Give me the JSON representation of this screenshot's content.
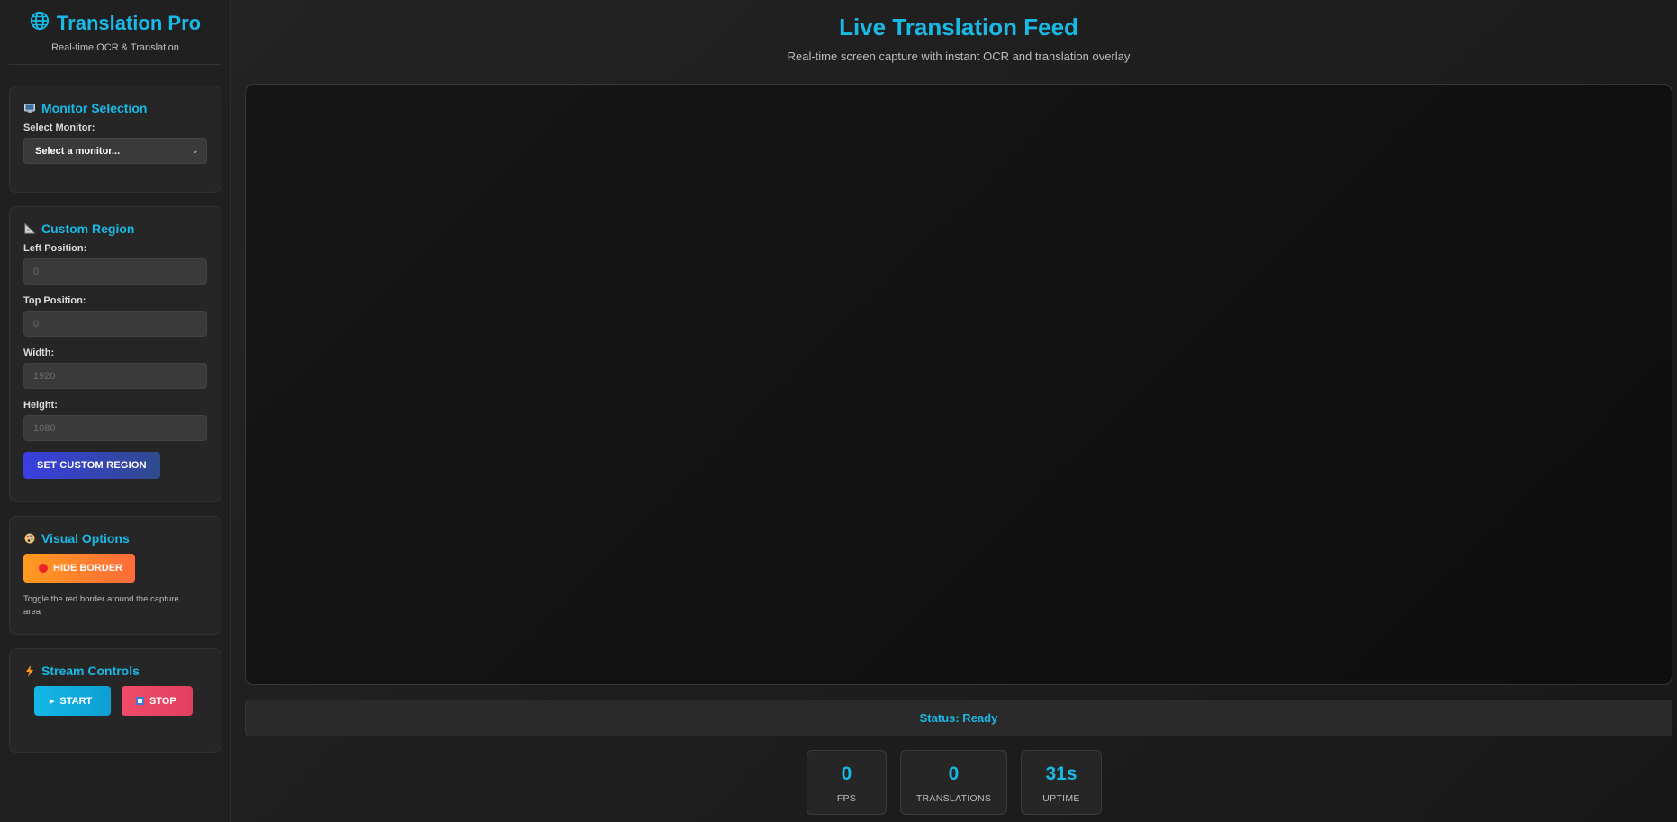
{
  "brand": {
    "title": "Translation Pro",
    "subtitle": "Real-time OCR & Translation",
    "icon": "globe-icon"
  },
  "monitor": {
    "title": "Monitor Selection",
    "icon": "monitor-icon",
    "label": "Select Monitor:",
    "selected": "Select a monitor..."
  },
  "region": {
    "title": "Custom Region",
    "icon": "triangle-ruler-icon",
    "left_label": "Left Position:",
    "left_placeholder": "0",
    "top_label": "Top Position:",
    "top_placeholder": "0",
    "width_label": "Width:",
    "width_placeholder": "1920",
    "height_label": "Height:",
    "height_placeholder": "1080",
    "button": "SET CUSTOM REGION"
  },
  "visual": {
    "title": "Visual Options",
    "icon": "palette-icon",
    "button": "HIDE BORDER",
    "help": "Toggle the red border around the capture area"
  },
  "stream": {
    "title": "Stream Controls",
    "icon": "lightning-icon",
    "start": "START",
    "stop": "STOP"
  },
  "main": {
    "title": "Live Translation Feed",
    "subtitle": "Real-time screen capture with instant OCR and translation overlay",
    "status": "Status: Ready"
  },
  "stats": [
    {
      "value": "0",
      "label": "FPS"
    },
    {
      "value": "0",
      "label": "TRANSLATIONS"
    },
    {
      "value": "31s",
      "label": "UPTIME"
    }
  ],
  "colors": {
    "accent": "#19b9e6",
    "region_button": "#3a3fe0",
    "border_button": "#ff8a2a",
    "start_button": "#13b7e8",
    "stop_button": "#f04b6a"
  }
}
